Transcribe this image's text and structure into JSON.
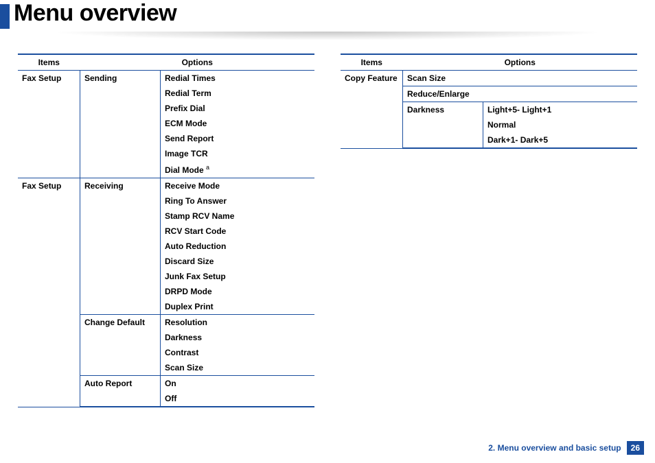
{
  "title": "Menu overview",
  "footer": {
    "chapter": "2. Menu overview and basic setup",
    "page": "26"
  },
  "headers": {
    "items": "Items",
    "options": "Options"
  },
  "left_table": {
    "rows": [
      {
        "item": "Fax Setup",
        "groups": [
          {
            "sub": "Sending",
            "opts": [
              "Redial Times",
              "Redial Term",
              "Prefix Dial",
              "ECM Mode",
              "Send Report",
              "Image TCR",
              "Dial Mode"
            ],
            "fn_on_last": "a"
          }
        ]
      },
      {
        "item": "Fax Setup",
        "groups": [
          {
            "sub": "Receiving",
            "opts": [
              "Receive Mode",
              "Ring To Answer",
              "Stamp RCV Name",
              "RCV Start Code",
              "Auto Reduction",
              "Discard Size",
              "Junk Fax Setup",
              "DRPD Mode",
              "Duplex Print"
            ]
          },
          {
            "sub": "Change Default",
            "opts": [
              "Resolution",
              "Darkness",
              "Contrast",
              "Scan Size"
            ]
          },
          {
            "sub": "Auto Report",
            "opts": [
              "On",
              "Off"
            ]
          }
        ]
      }
    ]
  },
  "right_table": {
    "rows": [
      {
        "item": "Copy Feature",
        "groups": [
          {
            "sub": "Scan Size",
            "opts": [],
            "span": true
          },
          {
            "sub": "Reduce/Enlarge",
            "opts": [],
            "span": true
          },
          {
            "sub": "Darkness",
            "opts": [
              "Light+5- Light+1",
              "Normal",
              "Dark+1- Dark+5"
            ]
          }
        ]
      }
    ]
  }
}
